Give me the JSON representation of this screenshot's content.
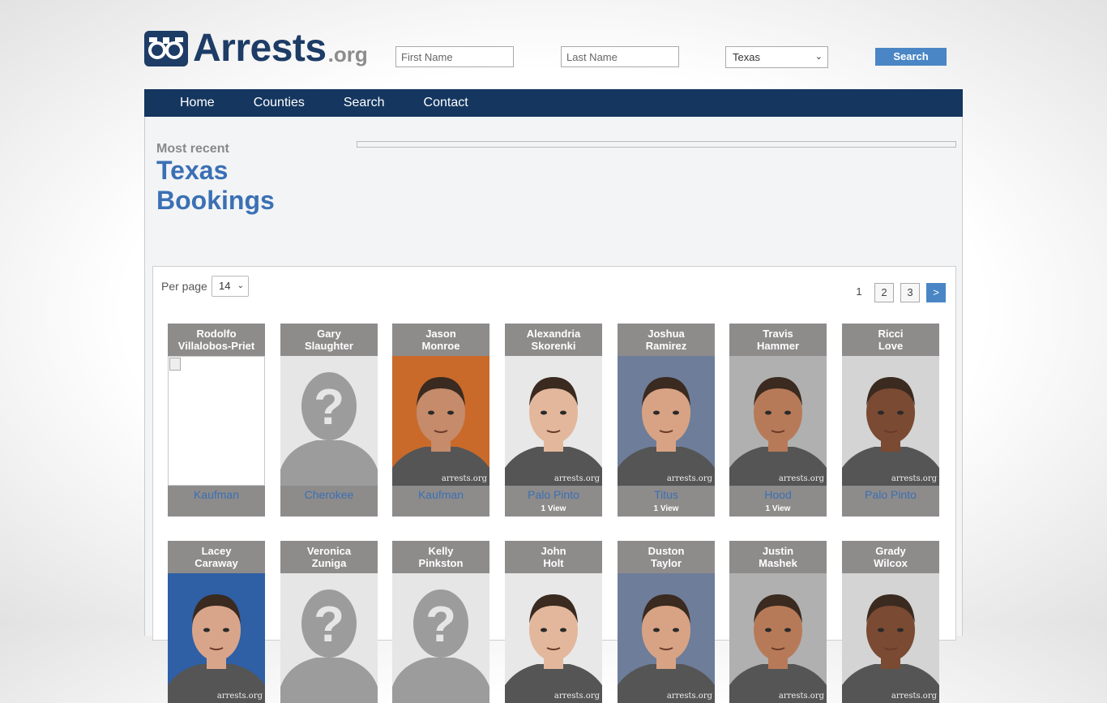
{
  "header": {
    "logo_text": "Arrests",
    "logo_suffix": ".org",
    "first_name_placeholder": "First Name",
    "last_name_placeholder": "Last Name",
    "state_selected": "Texas",
    "search_label": "Search"
  },
  "nav": {
    "items": [
      "Home",
      "Counties",
      "Search",
      "Contact"
    ]
  },
  "page": {
    "subtitle": "Most recent",
    "title_line1": "Texas",
    "title_line2": "Bookings"
  },
  "listing": {
    "per_page_label": "Per page",
    "per_page_value": "14",
    "pages": [
      "1",
      "2",
      "3",
      ">"
    ]
  },
  "bookings": [
    {
      "first": "Rodolfo",
      "last": "Villalobos-Priet",
      "county": "Kaufman",
      "views": "",
      "photo": "broken"
    },
    {
      "first": "Gary",
      "last": "Slaughter",
      "county": "Cherokee",
      "views": "",
      "photo": "placeholder"
    },
    {
      "first": "Jason",
      "last": "Monroe",
      "county": "Kaufman",
      "views": "",
      "photo": "mugshot"
    },
    {
      "first": "Alexandria",
      "last": "Skorenki",
      "county": "Palo Pinto",
      "views": "1 View",
      "photo": "mugshot"
    },
    {
      "first": "Joshua",
      "last": "Ramirez",
      "county": "Titus",
      "views": "1 View",
      "photo": "mugshot"
    },
    {
      "first": "Travis",
      "last": "Hammer",
      "county": "Hood",
      "views": "1 View",
      "photo": "mugshot"
    },
    {
      "first": "Ricci",
      "last": "Love",
      "county": "Palo Pinto",
      "views": "",
      "photo": "mugshot"
    },
    {
      "first": "Lacey",
      "last": "Caraway",
      "county": "",
      "views": "",
      "photo": "mugshot"
    },
    {
      "first": "Veronica",
      "last": "Zuniga",
      "county": "",
      "views": "",
      "photo": "placeholder"
    },
    {
      "first": "Kelly",
      "last": "Pinkston",
      "county": "",
      "views": "",
      "photo": "placeholder"
    },
    {
      "first": "John",
      "last": "Holt",
      "county": "",
      "views": "",
      "photo": "mugshot"
    },
    {
      "first": "Duston",
      "last": "Taylor",
      "county": "",
      "views": "",
      "photo": "mugshot"
    },
    {
      "first": "Justin",
      "last": "Mashek",
      "county": "",
      "views": "",
      "photo": "mugshot"
    },
    {
      "first": "Grady",
      "last": "Wilcox",
      "county": "",
      "views": "",
      "photo": "mugshot"
    }
  ],
  "watermark": "arrests.org",
  "colors": {
    "brand": "#1d3c66",
    "nav": "#14365f",
    "accent": "#4a86c5",
    "link": "#3b70b4",
    "card": "#8e8b8b"
  }
}
